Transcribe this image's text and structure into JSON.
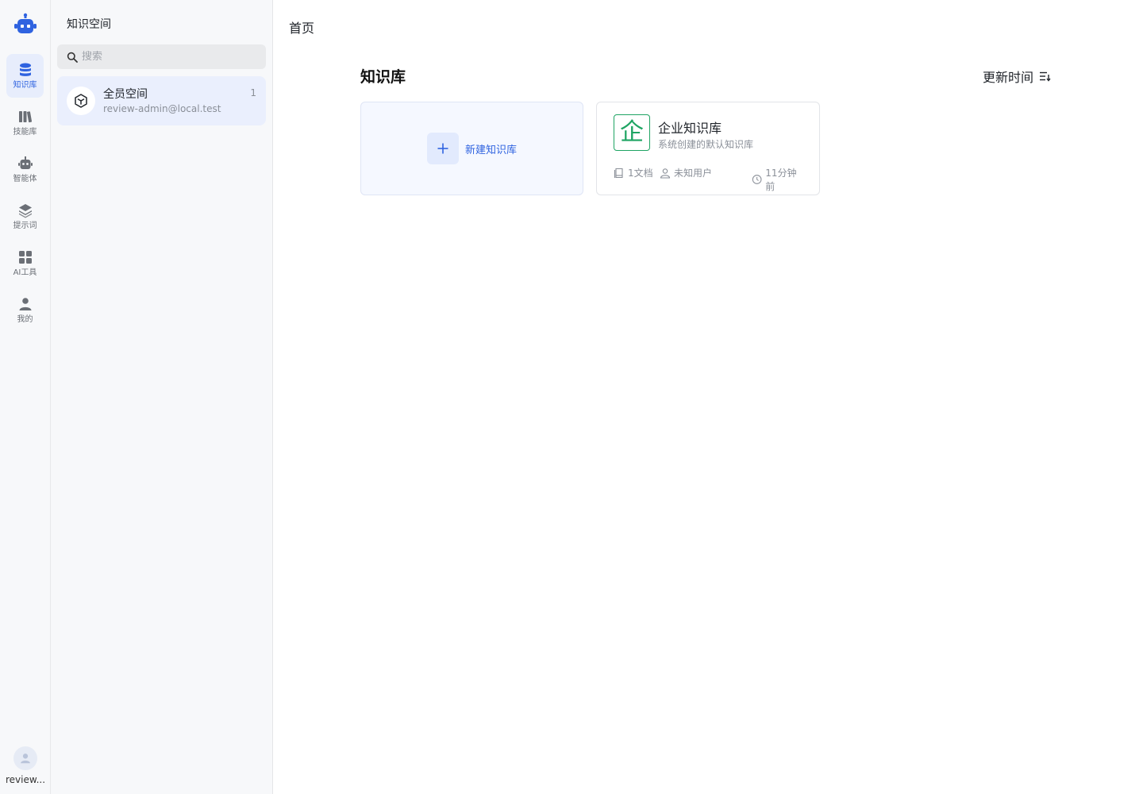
{
  "rail": {
    "items": [
      {
        "label": "知识库",
        "icon": "database-icon",
        "active": true
      },
      {
        "label": "技能库",
        "icon": "books-icon",
        "active": false
      },
      {
        "label": "智能体",
        "icon": "robot-icon",
        "active": false
      },
      {
        "label": "提示词",
        "icon": "layers-icon",
        "active": false
      },
      {
        "label": "AI工具",
        "icon": "grid-icon",
        "active": false
      },
      {
        "label": "我的",
        "icon": "person-icon",
        "active": false
      }
    ],
    "username": "review..."
  },
  "panel": {
    "title": "知识空间",
    "search_placeholder": "搜索",
    "spaces": [
      {
        "name": "全员空间",
        "email": "review-admin@local.test",
        "count": "1"
      }
    ]
  },
  "main": {
    "breadcrumb": "首页",
    "section_title": "知识库",
    "sort_label": "更新时间",
    "new_kb_label": "新建知识库",
    "cards": [
      {
        "avatar_char": "企",
        "name": "企业知识库",
        "description": "系统创建的默认知识库",
        "docs": "1文档",
        "user": "未知用户",
        "time": "11分钟前"
      }
    ]
  },
  "colors": {
    "accent": "#2f63e0",
    "active_bg": "#e7edfc",
    "kb_green": "#1fa463"
  }
}
